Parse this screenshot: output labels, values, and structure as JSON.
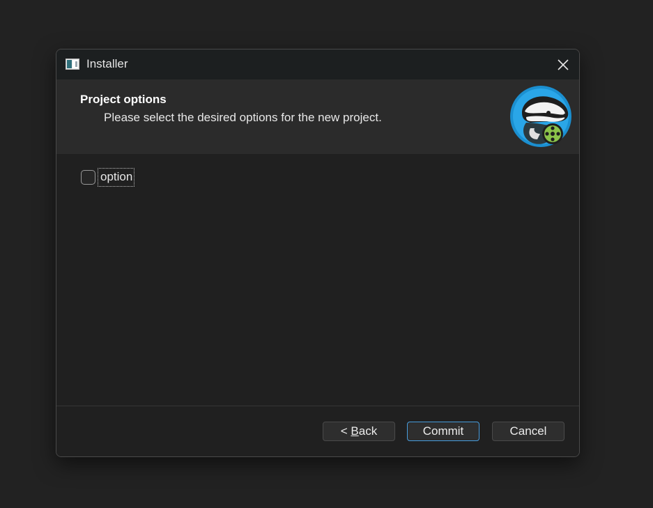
{
  "window": {
    "title": "Installer"
  },
  "header": {
    "title": "Project options",
    "subtitle": "Please select the desired options for the new project."
  },
  "options": [
    {
      "label": "option",
      "checked": false
    }
  ],
  "footer": {
    "back_prefix": "< ",
    "back_mnemonic": "B",
    "back_rest": "ack",
    "commit_label": "Commit",
    "cancel_label": "Cancel"
  },
  "colors": {
    "accent": "#4a9fe0",
    "logo_ring": "#1b8fd0",
    "logo_reel": "#8bc34a"
  },
  "icons": {
    "app": "installer-app-icon",
    "close": "close-icon",
    "logo": "badger-film-reel-logo"
  }
}
